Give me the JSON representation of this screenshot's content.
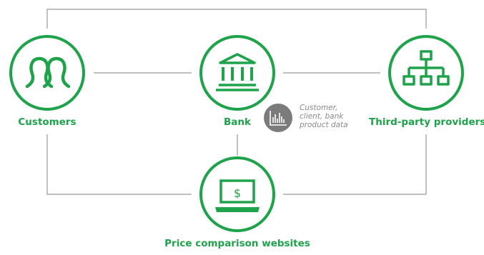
{
  "diagram": {
    "nodes": {
      "customers": {
        "label": "Customers",
        "icon": "customers-icon"
      },
      "bank": {
        "label": "Bank",
        "icon": "bank-icon"
      },
      "third_party": {
        "label": "Third-party providers",
        "icon": "hierarchy-icon"
      },
      "price_comparison": {
        "label": "Price comparison websites",
        "icon": "laptop-dollar-icon",
        "screen_symbol": "$"
      }
    },
    "data_badge": {
      "icon": "bar-chart-icon",
      "lines": [
        "Customer,",
        "client, bank",
        "product data"
      ]
    }
  },
  "colors": {
    "accent_green": "#1ea34b",
    "connector_gray": "#9a9a9a",
    "badge_gray": "#7b7b7b",
    "note_gray": "#8a8a8a"
  }
}
